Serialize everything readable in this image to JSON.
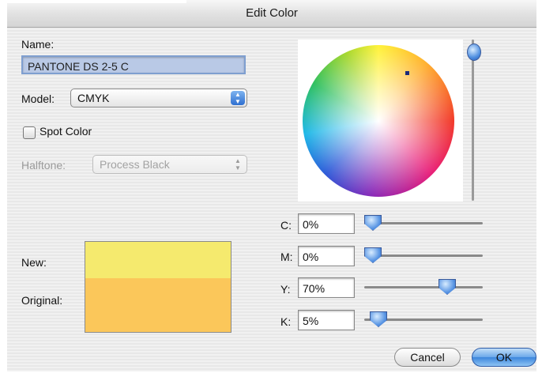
{
  "window": {
    "title": "Edit Color"
  },
  "name": {
    "label": "Name:",
    "value": "PANTONE DS 2-5 C"
  },
  "model": {
    "label": "Model:",
    "value": "CMYK"
  },
  "spot_color": {
    "label": "Spot Color",
    "checked": false
  },
  "halftone": {
    "label": "Halftone:",
    "value": "Process Black",
    "enabled": false
  },
  "swatch": {
    "new_label": "New:",
    "original_label": "Original:",
    "new_color": "#f5ea6e",
    "original_color": "#fbc75a"
  },
  "cmyk": [
    {
      "label": "C:",
      "value": "0%",
      "level": 0
    },
    {
      "label": "M:",
      "value": "0%",
      "level": 0
    },
    {
      "label": "Y:",
      "value": "70%",
      "level": 70
    },
    {
      "label": "K:",
      "value": "5%",
      "level": 5
    }
  ],
  "brightness_level": 100,
  "buttons": {
    "cancel": "Cancel",
    "ok": "OK"
  },
  "icons": [
    "popup-arrows-icon",
    "checkbox-icon",
    "color-wheel",
    "slider-thumb-icon"
  ]
}
